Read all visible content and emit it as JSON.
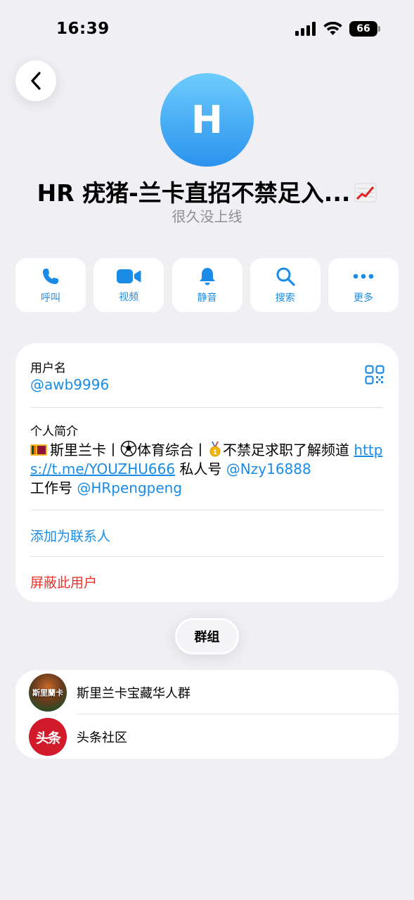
{
  "status_bar": {
    "time": "16:39",
    "battery": "66"
  },
  "header": {
    "back_icon": "chevron-left-icon"
  },
  "profile": {
    "avatar_letter": "H",
    "name": "HR 疣猪-兰卡直招不禁足入...",
    "name_emoji": "chart-increasing-icon",
    "status": "很久没上线"
  },
  "actions": [
    {
      "label": "呼叫",
      "icon": "phone-icon"
    },
    {
      "label": "视频",
      "icon": "video-icon"
    },
    {
      "label": "静音",
      "icon": "bell-icon"
    },
    {
      "label": "搜索",
      "icon": "search-icon"
    },
    {
      "label": "更多",
      "icon": "more-icon"
    }
  ],
  "info": {
    "username_label": "用户名",
    "username": "@awb9996",
    "bio_label": "个人简介",
    "bio": {
      "part1": "斯里兰卡丨",
      "part2": "体育综合丨",
      "part3": "不禁足求职了解频道 ",
      "link_url": "https://t.me/YOUZHU666",
      "part4": " 私人号 ",
      "mention1": "@Nzy16888",
      "part5": "工作号 ",
      "mention2": "@HRpengpeng"
    },
    "add_contact": "添加为联系人",
    "block_user": "屏蔽此用户"
  },
  "groups_header": "群组",
  "groups": [
    {
      "name": "斯里兰卡宝藏华人群",
      "avatar_text": "斯里蘭卡"
    },
    {
      "name": "头条社区",
      "avatar_text": "头条"
    }
  ],
  "colors": {
    "accent": "#1a8ce8",
    "danger": "#e8342a",
    "background": "#efeff4",
    "avatar_gradient_top": "#6dccfd",
    "avatar_gradient_bottom": "#2b93ee"
  }
}
